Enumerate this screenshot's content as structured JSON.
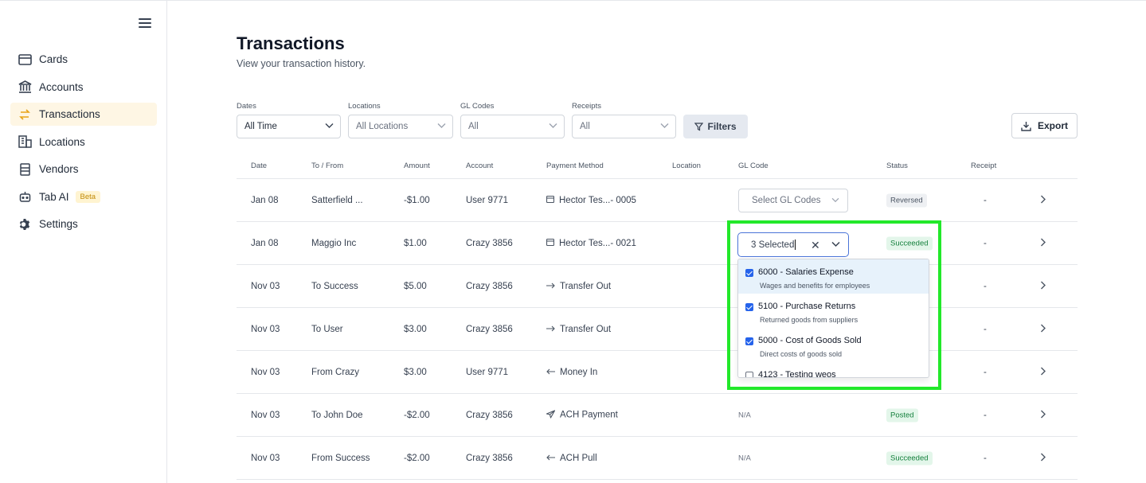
{
  "sidebar": {
    "items": [
      {
        "label": "Cards",
        "icon": "card-icon"
      },
      {
        "label": "Accounts",
        "icon": "bank-icon"
      },
      {
        "label": "Transactions",
        "icon": "swap-arrows-icon",
        "active": true
      },
      {
        "label": "Locations",
        "icon": "building-icon"
      },
      {
        "label": "Vendors",
        "icon": "vendors-icon"
      },
      {
        "label": "Tab AI",
        "icon": "robot-icon",
        "badge": "Beta"
      },
      {
        "label": "Settings",
        "icon": "gear-icon"
      }
    ]
  },
  "header": {
    "title": "Transactions",
    "subtitle": "View your transaction history."
  },
  "filters": {
    "dates": {
      "label": "Dates",
      "value": "All Time"
    },
    "locations": {
      "label": "Locations",
      "value": "All Locations"
    },
    "gl_codes": {
      "label": "GL Codes",
      "value": "All"
    },
    "receipts": {
      "label": "Receipts",
      "value": "All"
    },
    "filters_button": "Filters",
    "export_button": "Export"
  },
  "table": {
    "columns": [
      "Date",
      "To / From",
      "Amount",
      "Account",
      "Payment Method",
      "Location",
      "GL Code",
      "Status",
      "Receipt"
    ],
    "rows": [
      {
        "date": "Jan 08",
        "to_from": "Satterfield ...",
        "amount": "-$1.00",
        "account": "User 9771",
        "pm_icon": "card-icon",
        "payment_method": "Hector Tes...- 0005",
        "location": "",
        "gl": "Select GL Codes",
        "status": "Reversed",
        "status_kind": "reversed",
        "receipt": "-"
      },
      {
        "date": "Jan 08",
        "to_from": "Maggio Inc",
        "amount": "$1.00",
        "account": "Crazy 3856",
        "pm_icon": "card-icon",
        "payment_method": "Hector Tes...- 0021",
        "location": "",
        "gl": "",
        "status": "Succeeded",
        "status_kind": "succeeded",
        "receipt": "-"
      },
      {
        "date": "Nov 03",
        "to_from": "To Success",
        "amount": "$5.00",
        "account": "Crazy 3856",
        "pm_icon": "arrow-right-icon",
        "payment_method": "Transfer Out",
        "location": "",
        "gl": "",
        "status": "",
        "status_kind": "",
        "receipt": "-"
      },
      {
        "date": "Nov 03",
        "to_from": "To User",
        "amount": "$3.00",
        "account": "Crazy 3856",
        "pm_icon": "arrow-right-icon",
        "payment_method": "Transfer Out",
        "location": "",
        "gl": "",
        "status": "",
        "status_kind": "",
        "receipt": "-"
      },
      {
        "date": "Nov 03",
        "to_from": "From Crazy",
        "amount": "$3.00",
        "account": "User 9771",
        "pm_icon": "arrow-left-icon",
        "payment_method": "Money In",
        "location": "",
        "gl": "",
        "status": "",
        "status_kind": "",
        "receipt": "-"
      },
      {
        "date": "Nov 03",
        "to_from": "To John Doe",
        "amount": "-$2.00",
        "account": "Crazy 3856",
        "pm_icon": "send-icon",
        "payment_method": "ACH Payment",
        "location": "",
        "gl": "N/A",
        "status": "Posted",
        "status_kind": "posted",
        "receipt": "-"
      },
      {
        "date": "Nov 03",
        "to_from": "From Success",
        "amount": "-$2.00",
        "account": "Crazy 3856",
        "pm_icon": "arrow-left-icon",
        "payment_method": "ACH Pull",
        "location": "",
        "gl": "N/A",
        "status": "Succeeded",
        "status_kind": "succeeded",
        "receipt": "-"
      }
    ]
  },
  "gl_dropdown": {
    "input_value": "3 Selected",
    "options": [
      {
        "title": "6000 - Salaries Expense",
        "desc": "Wages and benefits for employees",
        "checked": true
      },
      {
        "title": "5100 - Purchase Returns",
        "desc": "Returned goods from suppliers",
        "checked": true
      },
      {
        "title": "5000 - Cost of Goods Sold",
        "desc": "Direct costs of goods sold",
        "checked": true
      },
      {
        "title": "4123 - Testing weos",
        "desc": "",
        "checked": false
      }
    ]
  },
  "colors": {
    "accent": "#e8a317",
    "active_bg": "#fef6e4",
    "highlight": "#22e82a",
    "focus": "#4a74d8",
    "checkbox": "#2563eb"
  }
}
